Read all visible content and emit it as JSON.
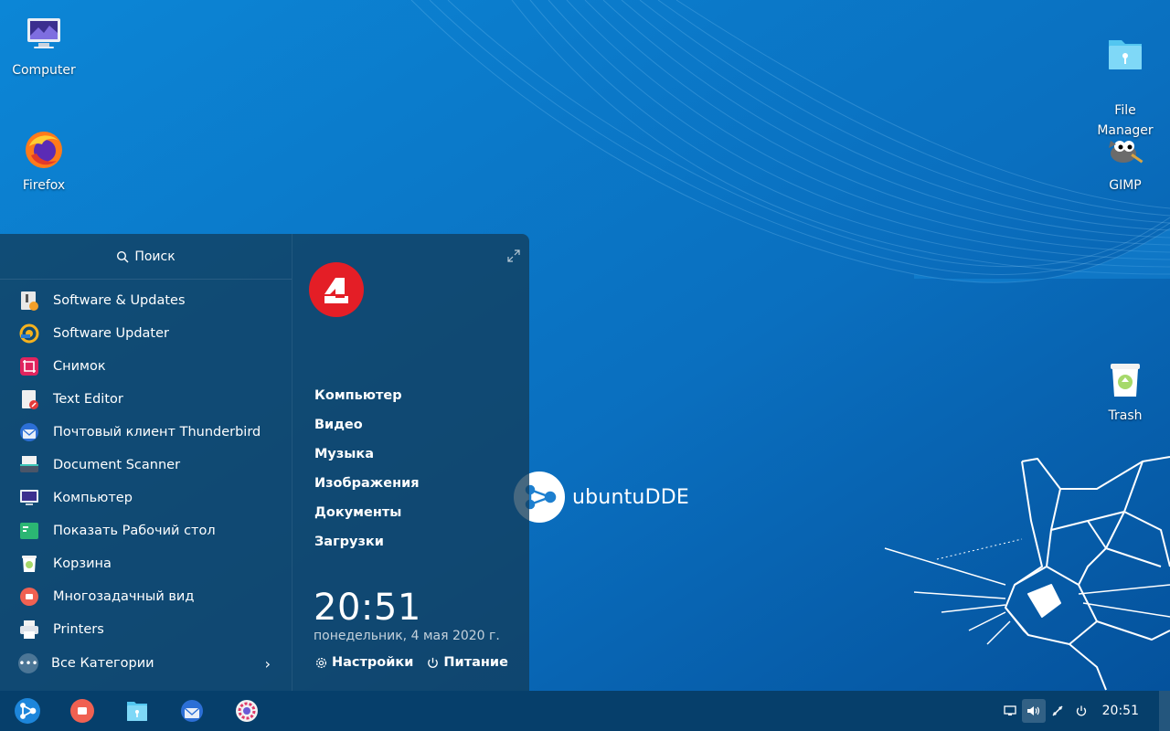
{
  "desktop": {
    "icons": [
      {
        "label": "Computer",
        "icon": "computer-icon"
      },
      {
        "label": "Firefox",
        "icon": "firefox-icon"
      },
      {
        "label": "File\nManager",
        "icon": "file-manager-icon"
      },
      {
        "label": "GIMP",
        "icon": "gimp-icon"
      },
      {
        "label": "Trash",
        "icon": "trash-icon"
      }
    ],
    "brand": "ubuntuDDE"
  },
  "launcher": {
    "search_label": "Поиск",
    "apps": [
      {
        "label": "Software & Updates",
        "icon": "software-updates-icon"
      },
      {
        "label": "Software Updater",
        "icon": "software-updater-icon"
      },
      {
        "label": "Снимок",
        "icon": "screenshot-icon"
      },
      {
        "label": "Text Editor",
        "icon": "text-editor-icon"
      },
      {
        "label": "Почтовый клиент Thunderbird",
        "icon": "thunderbird-icon"
      },
      {
        "label": "Document Scanner",
        "icon": "scanner-icon"
      },
      {
        "label": "Компьютер",
        "icon": "computer-icon"
      },
      {
        "label": "Показать Рабочий стол",
        "icon": "show-desktop-icon"
      },
      {
        "label": "Корзина",
        "icon": "trash-icon"
      },
      {
        "label": "Многозадачный вид",
        "icon": "multitasking-icon"
      },
      {
        "label": "Printers",
        "icon": "printer-icon"
      }
    ],
    "all_categories": "Все Категории",
    "places": [
      "Компьютер",
      "Видео",
      "Музыка",
      "Изображения",
      "Документы",
      "Загрузки"
    ],
    "clock": {
      "time": "20:51",
      "date": "понедельник, 4 мая 2020 г."
    },
    "settings_label": "Настройки",
    "power_label": "Питание"
  },
  "taskbar": {
    "apps": [
      "launcher-icon",
      "multitasking-icon",
      "file-manager-icon",
      "thunderbird-icon",
      "settings-icon"
    ],
    "tray": [
      "notification-icon",
      "volume-icon",
      "network-icon",
      "power-icon"
    ],
    "time": "20:51"
  },
  "colors": {
    "accent": "#0a7fd0",
    "taskbar": "#063f6b",
    "launcher": "#123e5c"
  }
}
